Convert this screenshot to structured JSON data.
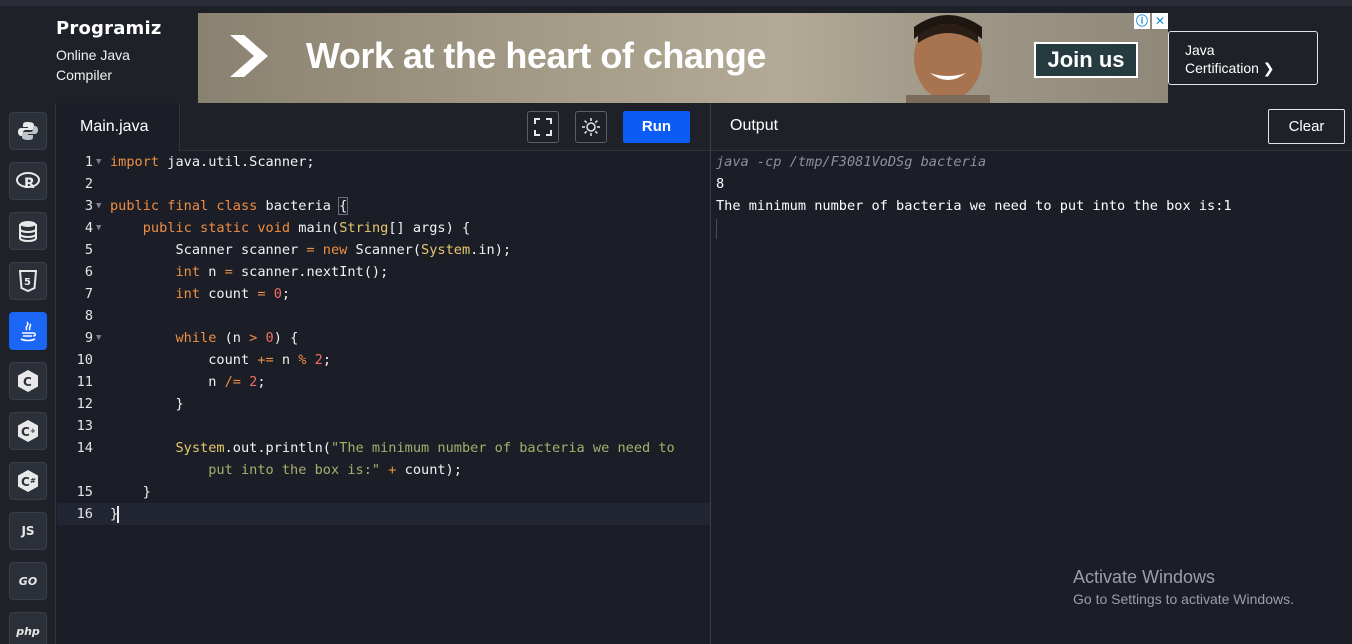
{
  "brand": {
    "logo": "Programiz",
    "subtitle_line1": "Online Java",
    "subtitle_line2": "Compiler"
  },
  "ad": {
    "headline": "Work at the heart of change",
    "cta": "Join us",
    "badge_info": "ⓘ",
    "badge_close": "✕"
  },
  "certification": {
    "line1": "Java",
    "line2": "Certification ❯"
  },
  "sidebar": {
    "items": [
      {
        "name": "python",
        "label": ""
      },
      {
        "name": "r",
        "label": "R"
      },
      {
        "name": "sql",
        "label": ""
      },
      {
        "name": "html",
        "label": "5"
      },
      {
        "name": "java",
        "label": ""
      },
      {
        "name": "c",
        "label": "C"
      },
      {
        "name": "cpp",
        "label": "C+"
      },
      {
        "name": "csharp",
        "label": "C#"
      },
      {
        "name": "js",
        "label": "JS"
      },
      {
        "name": "go",
        "label": "GO"
      },
      {
        "name": "php",
        "label": "php"
      }
    ],
    "active": "java"
  },
  "editor": {
    "tab_label": "Main.java",
    "run_label": "Run",
    "line_numbers": [
      "1",
      "2",
      "3",
      "4",
      "5",
      "6",
      "7",
      "8",
      "9",
      "10",
      "11",
      "12",
      "13",
      "14",
      "",
      "15",
      "16"
    ],
    "code_lines": [
      "import java.util.Scanner;",
      "",
      "public final class bacteria {",
      "    public static void main(String[] args) {",
      "        Scanner scanner = new Scanner(System.in);",
      "        int n = scanner.nextInt();",
      "        int count = 0;",
      "",
      "        while (n > 0) {",
      "            count += n % 2;",
      "            n /= 2;",
      "        }",
      "",
      "        System.out.println(\"The minimum number of bacteria we need to",
      "            put into the box is:\" + count);",
      "    }",
      "}"
    ]
  },
  "output": {
    "title": "Output",
    "clear_label": "Clear",
    "command": "java -cp /tmp/F3081VoDSg bacteria",
    "lines": [
      "8",
      "The minimum number of bacteria we need to put into the box is:1"
    ]
  },
  "watermark": {
    "line1": "Activate Windows",
    "line2": "Go to Settings to activate Windows."
  },
  "colors": {
    "accent": "#0b5cf4",
    "keyword": "#ee8e42",
    "type": "#e7c76c",
    "number": "#f06f62",
    "string": "#a8ae6c"
  }
}
